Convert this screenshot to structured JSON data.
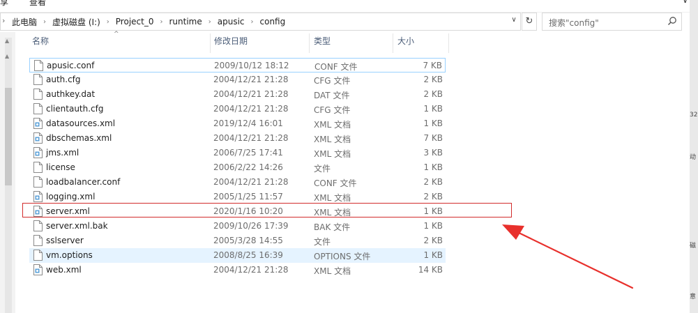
{
  "ribbon": {
    "left_tab": "享",
    "tab2": "查看",
    "window_controls": "∨"
  },
  "address": {
    "breadcrumbs": [
      "此电脑",
      "虚拟磁盘 (I:)",
      "Project_0",
      "runtime",
      "apusic",
      "config"
    ],
    "lead_glyph": "›",
    "dropdown_glyph": "∨",
    "refresh_glyph": "↻"
  },
  "search": {
    "placeholder": "搜索\"config\""
  },
  "columns": {
    "name": "名称",
    "date": "修改日期",
    "type": "类型",
    "size": "大小",
    "sort_glyph": "^"
  },
  "files": [
    {
      "name": "apusic.conf",
      "date": "2009/10/12 18:12",
      "type": "CONF 文件",
      "size": "7 KB",
      "icon": "file-icon"
    },
    {
      "name": "auth.cfg",
      "date": "2004/12/21 21:28",
      "type": "CFG 文件",
      "size": "2 KB",
      "icon": "file-icon"
    },
    {
      "name": "authkey.dat",
      "date": "2004/12/21 21:28",
      "type": "DAT 文件",
      "size": "2 KB",
      "icon": "file-icon"
    },
    {
      "name": "clientauth.cfg",
      "date": "2004/12/21 21:28",
      "type": "CFG 文件",
      "size": "1 KB",
      "icon": "file-icon"
    },
    {
      "name": "datasources.xml",
      "date": "2019/12/4 16:01",
      "type": "XML 文档",
      "size": "1 KB",
      "icon": "xml-icon"
    },
    {
      "name": "dbschemas.xml",
      "date": "2004/12/21 21:28",
      "type": "XML 文档",
      "size": "7 KB",
      "icon": "xml-icon"
    },
    {
      "name": "jms.xml",
      "date": "2006/7/25 17:41",
      "type": "XML 文档",
      "size": "3 KB",
      "icon": "xml-icon"
    },
    {
      "name": "license",
      "date": "2006/2/22 14:26",
      "type": "文件",
      "size": "1 KB",
      "icon": "file-icon"
    },
    {
      "name": "loadbalancer.conf",
      "date": "2004/12/21 21:28",
      "type": "CONF 文件",
      "size": "2 KB",
      "icon": "file-icon"
    },
    {
      "name": "logging.xml",
      "date": "2005/1/25 11:57",
      "type": "XML 文档",
      "size": "2 KB",
      "icon": "xml-icon"
    },
    {
      "name": "server.xml",
      "date": "2020/1/16 10:20",
      "type": "XML 文档",
      "size": "1 KB",
      "icon": "xml-icon"
    },
    {
      "name": "server.xml.bak",
      "date": "2009/10/26 17:39",
      "type": "BAK 文件",
      "size": "1 KB",
      "icon": "file-icon"
    },
    {
      "name": "sslserver",
      "date": "2005/3/28 14:55",
      "type": "文件",
      "size": "2 KB",
      "icon": "file-icon"
    },
    {
      "name": "vm.options",
      "date": "2008/8/25 16:39",
      "type": "OPTIONS 文件",
      "size": "1 KB",
      "icon": "file-icon"
    },
    {
      "name": "web.xml",
      "date": "2004/12/21 21:28",
      "type": "XML 文档",
      "size": "14 KB",
      "icon": "xml-icon"
    }
  ],
  "selected_index": 0,
  "hover_index": 13,
  "highlight_index": 10,
  "right_pane_text": [
    "32",
    "动",
    "磁",
    "意"
  ],
  "colors": {
    "highlight": "#d22b2b",
    "arrow": "#e8302c",
    "selection_border": "#99d1ff",
    "hover_bg": "#e5f3ff",
    "header_text": "#4b5d78"
  }
}
